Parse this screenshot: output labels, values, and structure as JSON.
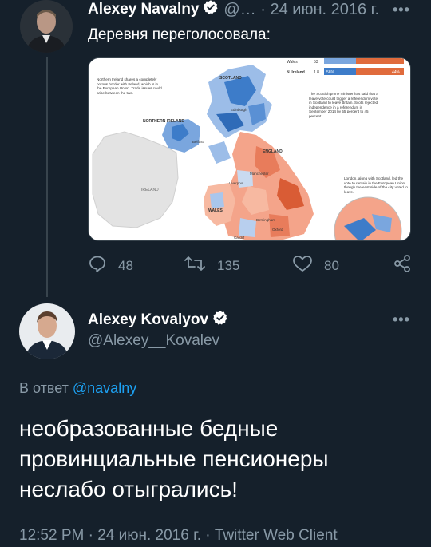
{
  "tweet1": {
    "author_name": "Alexey Navalny",
    "meta": "@… · 24 июн. 2016 г.",
    "text": "Деревня переголосовала:",
    "media": {
      "legend_rows": [
        {
          "region": "Wales",
          "pct": "53",
          "remain": "",
          "leave": ""
        },
        {
          "region": "N. Ireland",
          "pct": "1.8",
          "remain": "56%",
          "leave": "44%"
        }
      ],
      "labels": {
        "scotland": "SCOTLAND",
        "northern_ireland": "NORTHERN IRELAND",
        "england": "ENGLAND",
        "ireland": "IRELAND",
        "wales": "WALES",
        "edinburgh": "Edinburgh",
        "belfast": "Belfast",
        "liverpool": "Liverpool",
        "manchester": "Manchester",
        "birmingham": "Birmingham",
        "oxford": "Oxford",
        "cardiff": "Cardiff"
      },
      "notes": {
        "ni_border": "Northern Ireland shares a completely porous border with Ireland, which is in the European Union. Trade issues could arise between the two.",
        "scotland": "The Scottish prime minister has said that a leave vote could trigger a referendum vote in Scotland to leave Britain. Scots rejected independence in a referendum in September 2014 by 55 percent to 45 percent.",
        "london": "London, along with Scotland, led the vote to remain in the European Union, though the east side of the city voted to leave."
      }
    },
    "actions": {
      "replies": "48",
      "retweets": "135",
      "likes": "80"
    }
  },
  "tweet2": {
    "author_name": "Alexey Kovalyov",
    "handle": "@Alexey__Kovalev",
    "reply_prefix": "В ответ ",
    "reply_target": "@navalny",
    "text": "необразованные бедные провинциальные пенсионеры неслабо отыгрались!",
    "footer": "12:52 PM · 24 июн. 2016 г. · Twitter Web Client"
  },
  "colors": {
    "background": "#15202b",
    "muted": "#8899a6",
    "link": "#1da1f2",
    "remain_blue": "#3d7cc9",
    "leave_orange": "#e06b3c"
  },
  "icons": [
    "verified-badge-icon",
    "reply-icon",
    "retweet-icon",
    "like-icon",
    "share-icon",
    "more-icon"
  ]
}
